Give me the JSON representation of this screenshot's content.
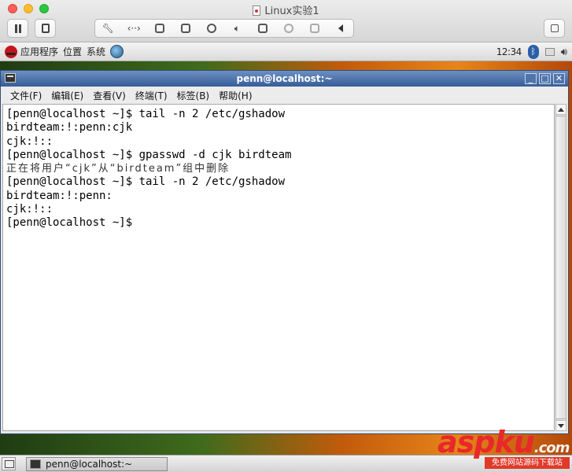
{
  "vm_window": {
    "title": "Linux实验1"
  },
  "gnome_panel": {
    "applications": "应用程序",
    "places": "位置",
    "system": "系统",
    "clock": "12:34"
  },
  "terminal": {
    "title": "penn@localhost:~",
    "menu": [
      {
        "label": "文件(F)"
      },
      {
        "label": "编辑(E)"
      },
      {
        "label": "查看(V)"
      },
      {
        "label": "终端(T)"
      },
      {
        "label": "标签(B)"
      },
      {
        "label": "帮助(H)"
      }
    ],
    "lines": [
      "[penn@localhost ~]$ tail -n 2 /etc/gshadow",
      "birdteam:!:penn:cjk",
      "cjk:!::",
      "[penn@localhost ~]$ gpasswd -d cjk birdteam",
      "正在将用户“cjk”从“birdteam”组中删除",
      "[penn@localhost ~]$ tail -n 2 /etc/gshadow",
      "birdteam:!:penn:",
      "cjk:!::",
      "[penn@localhost ~]$"
    ]
  },
  "taskbar": {
    "task_label": "penn@localhost:~"
  },
  "watermark": {
    "brand_a": "asp",
    "brand_b": "ku",
    "brand_dot": ".com",
    "sub": "免费网站源码下载站"
  }
}
